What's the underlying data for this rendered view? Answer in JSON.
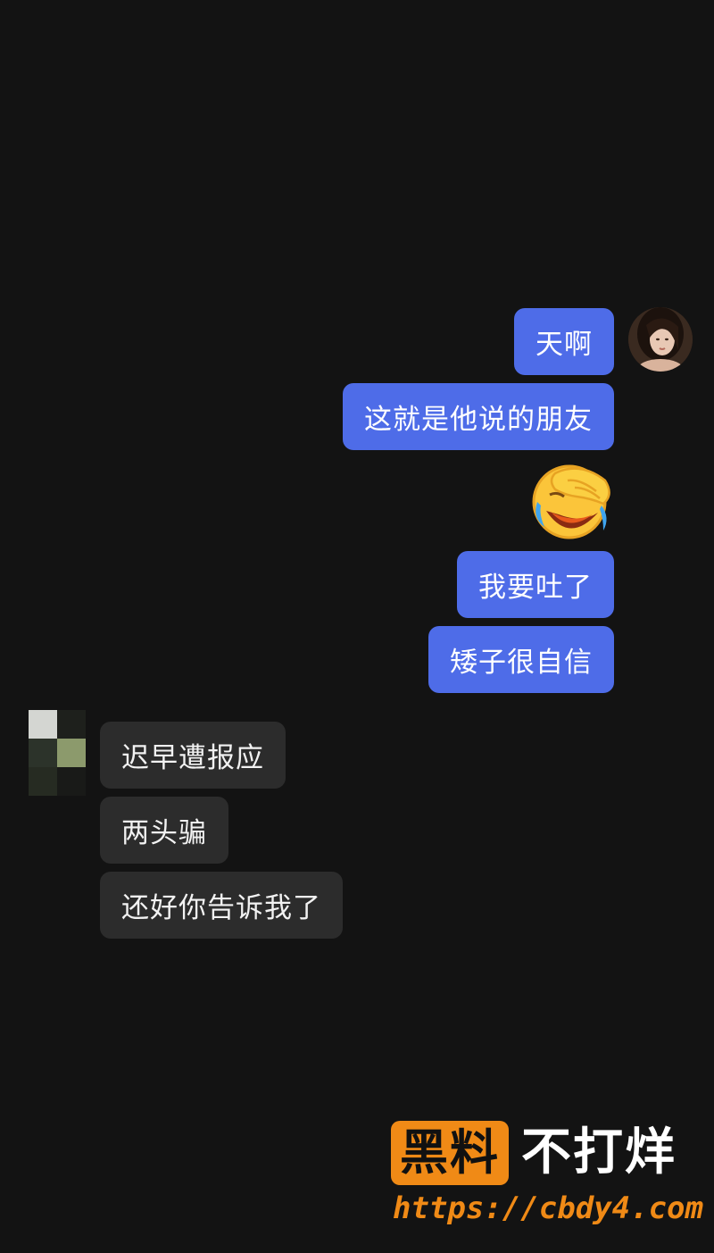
{
  "conversation": {
    "sent_messages": [
      {
        "type": "text",
        "text": "天啊"
      },
      {
        "type": "text",
        "text": "这就是他说的朋友"
      },
      {
        "type": "emoji",
        "icon": "facepalm-laughing-emoji"
      },
      {
        "type": "text",
        "text": "我要吐了"
      },
      {
        "type": "text",
        "text": "矮子很自信"
      }
    ],
    "received_messages": [
      {
        "type": "text",
        "text": "迟早遭报应"
      },
      {
        "type": "text",
        "text": "两头骗"
      },
      {
        "type": "text",
        "text": "还好你告诉我了"
      }
    ]
  },
  "avatars": {
    "self": {
      "icon": "user-avatar-photo"
    },
    "other": {
      "icon": "pixelated-avatar"
    }
  },
  "watermark": {
    "badge": "黑料",
    "text": "不打烊",
    "url": "https://cbdy4.com",
    "colors": {
      "accent": "#f08a16",
      "text": "#ffffff"
    }
  },
  "colors": {
    "background": "#131313",
    "sent_bubble": "#4e6ce8",
    "received_bubble": "#2c2c2c"
  }
}
